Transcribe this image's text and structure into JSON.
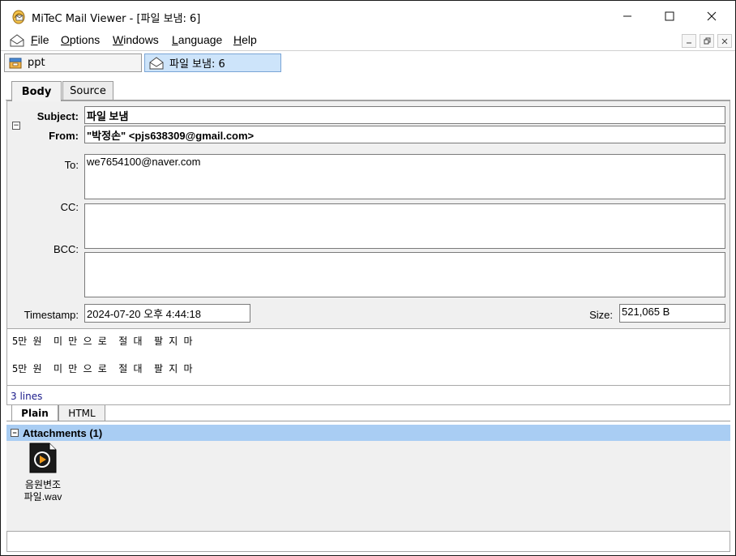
{
  "window": {
    "title": "MiTeC Mail Viewer - [파일 보냄: 6]",
    "controls": {
      "minimize": "—",
      "maximize": "☐",
      "close": "✕"
    }
  },
  "menu": {
    "items": [
      {
        "label": "File",
        "accel": "F",
        "rest": "ile"
      },
      {
        "label": "Options",
        "accel": "O",
        "rest": "ptions"
      },
      {
        "label": "Windows",
        "accel": "W",
        "rest": "indows"
      },
      {
        "label": "Language",
        "accel": "L",
        "rest": "anguage"
      },
      {
        "label": "Help",
        "accel": "H",
        "rest": "elp"
      }
    ],
    "mdi": {
      "minimize": "‗",
      "restore": "❐",
      "close": "✕"
    }
  },
  "doc_tabs": [
    {
      "label": "ppt",
      "icon": "archive-icon"
    },
    {
      "label": "파일 보냄: 6",
      "icon": "envelope-icon"
    }
  ],
  "view_tabs": {
    "body": "Body",
    "source": "Source"
  },
  "header": {
    "subject_label": "Subject:",
    "subject": "파일 보냄",
    "from_label": "From:",
    "from": "\"박정손\" <pjs638309@gmail.com>",
    "to_label": "To:",
    "to": "we7654100@naver.com",
    "cc_label": "CC:",
    "cc": "",
    "bcc_label": "BCC:",
    "bcc": "",
    "timestamp_label": "Timestamp:",
    "timestamp": "2024-07-20 오후 4:44:18",
    "size_label": "Size:",
    "size": "521,065 B"
  },
  "body": {
    "lines": [
      "5만 원  미 만 으 로  절 대  팔 지 마",
      "",
      "5만 원  미 만 으 로  절 대  팔 지 마"
    ]
  },
  "status": {
    "lines": "3 lines"
  },
  "format_tabs": {
    "plain": "Plain",
    "html": "HTML"
  },
  "attachments": {
    "header": "Attachments (1)",
    "items": [
      {
        "name_line1": "음원변조",
        "name_line2": "파일.wav",
        "icon": "audio-file-icon"
      }
    ]
  },
  "colors": {
    "accent": "#a9cdf3",
    "active_tab": "#cde4fa",
    "panel": "#f0f0f0"
  }
}
